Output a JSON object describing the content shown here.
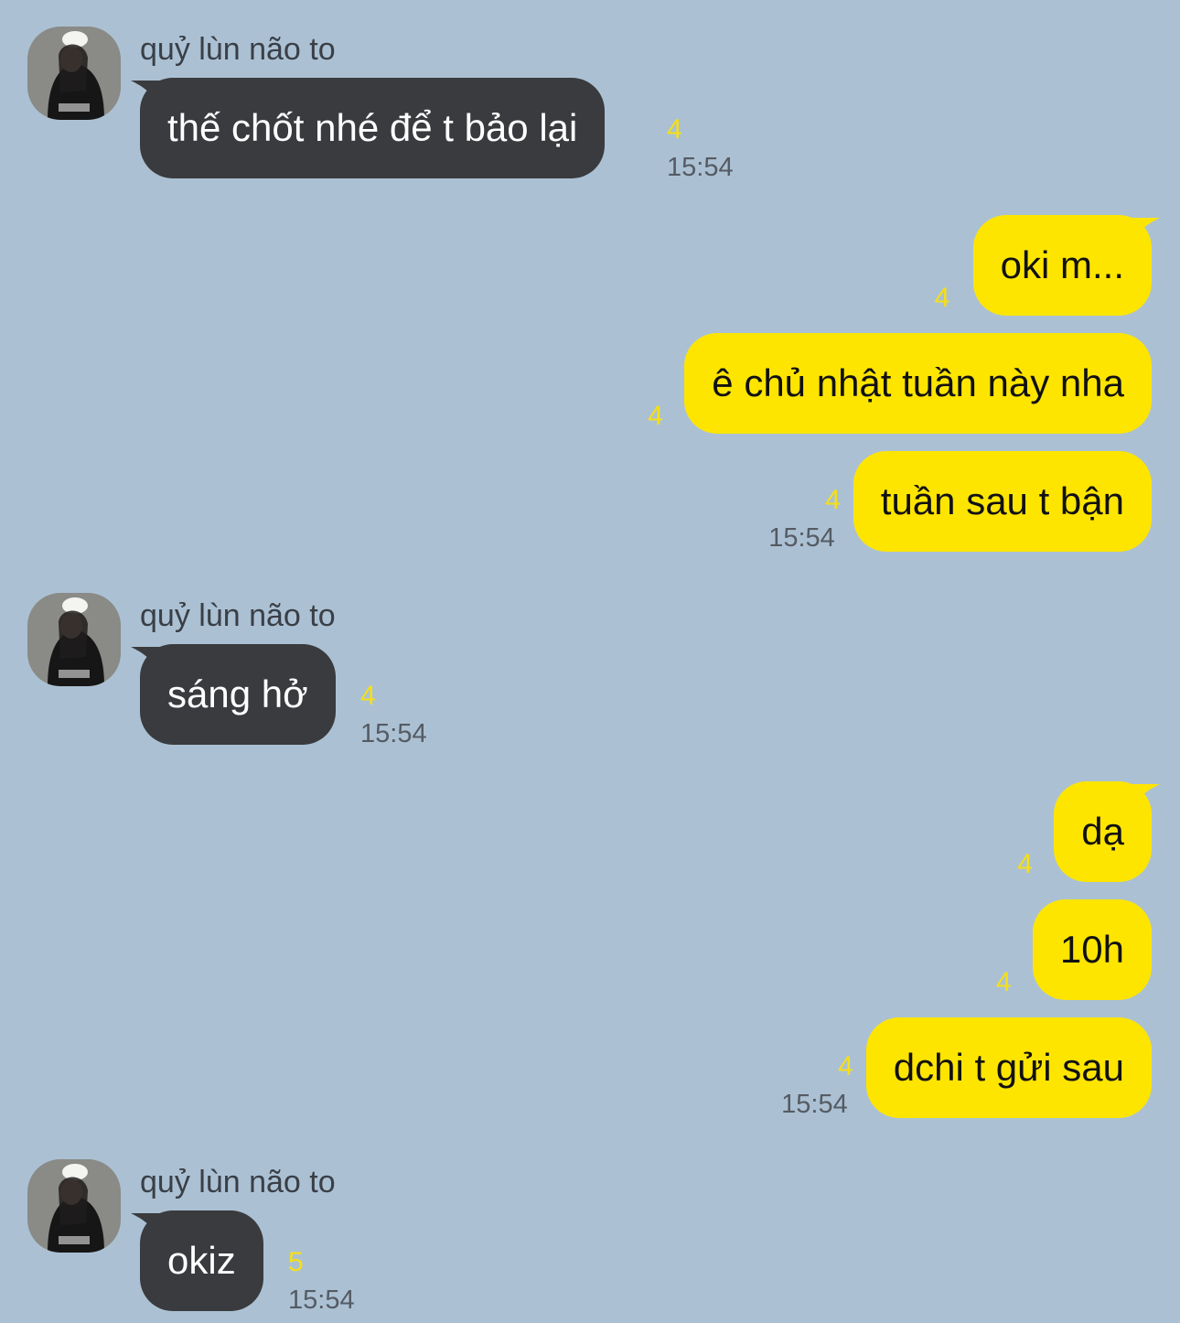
{
  "conversation": {
    "contact_name": "quỷ lùn não to",
    "group1": {
      "message": "thế chốt nhé để t bảo lại",
      "unread": "4",
      "time": "15:54"
    },
    "reply1": [
      {
        "text": "oki m...",
        "unread": "4"
      },
      {
        "text": "ê chủ nhật tuần này nha",
        "unread": "4"
      },
      {
        "text": "tuần sau t bận",
        "unread": "4",
        "time": "15:54"
      }
    ],
    "group2": {
      "message": "sáng hở",
      "unread": "4",
      "time": "15:54"
    },
    "reply2": [
      {
        "text": "dạ",
        "unread": "4"
      },
      {
        "text": "10h",
        "unread": "4"
      },
      {
        "text": "dchi t gửi sau",
        "unread": "4",
        "time": "15:54"
      }
    ],
    "group3": {
      "message": "okiz",
      "unread": "5",
      "time": "15:54"
    }
  },
  "colors": {
    "background": "#abc1d3",
    "incoming_bubble": "#3a3b3e",
    "outgoing_bubble": "#fee500",
    "unread_count": "#f5df18",
    "timestamp": "#555b64"
  },
  "icons": [
    "avatar-photo"
  ]
}
